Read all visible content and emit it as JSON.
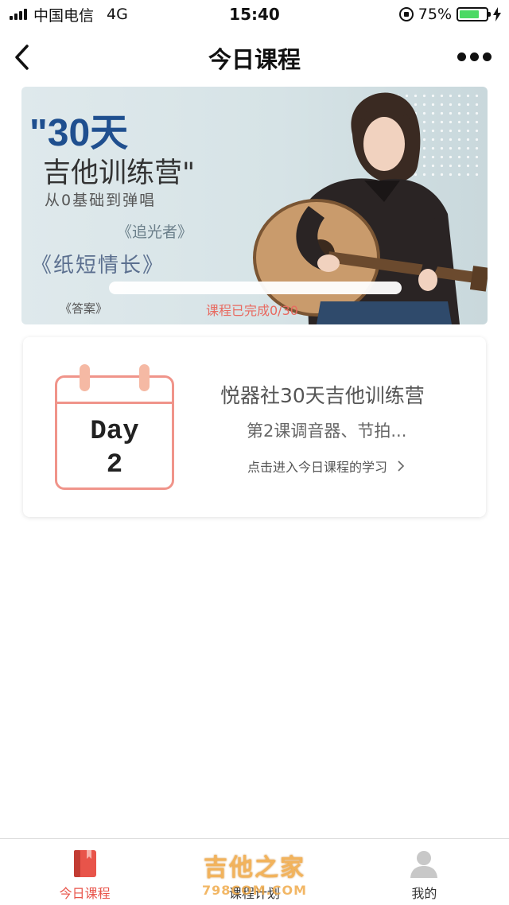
{
  "status_bar": {
    "carrier": "中国电信",
    "network": "4G",
    "time": "15:40",
    "battery_percent": "75%",
    "battery_level": 0.75
  },
  "navbar": {
    "title": "今日课程",
    "back_icon": "chevron-left-icon",
    "more_icon": "more-dots-icon"
  },
  "banner": {
    "title_line1": "\"30天",
    "title_line2": "吉他训练营\"",
    "subtitle": "从0基础到弹唱",
    "song1": "《追光者》",
    "song2": "《纸短情长》",
    "song3": "《答案》",
    "progress_text": "课程已完成0/30",
    "progress_value": 0
  },
  "course_card": {
    "day_label": "Day",
    "day_number": "2",
    "title": "悦器社30天吉他训练营",
    "lesson": "第2课调音器、节拍...",
    "link_text": "点击进入今日课程的学习"
  },
  "tabbar": {
    "tabs": [
      {
        "label": "今日课程",
        "icon": "book-icon",
        "active": true
      },
      {
        "label": "课程计划",
        "icon": "plan-icon",
        "active": false
      },
      {
        "label": "我的",
        "icon": "person-icon",
        "active": false
      }
    ]
  },
  "watermark": {
    "line1": "吉他之家",
    "line2": "798COM.COM"
  },
  "colors": {
    "accent": "#e8544a",
    "calendar": "#f0948a",
    "banner_title": "#1f4f8f"
  }
}
